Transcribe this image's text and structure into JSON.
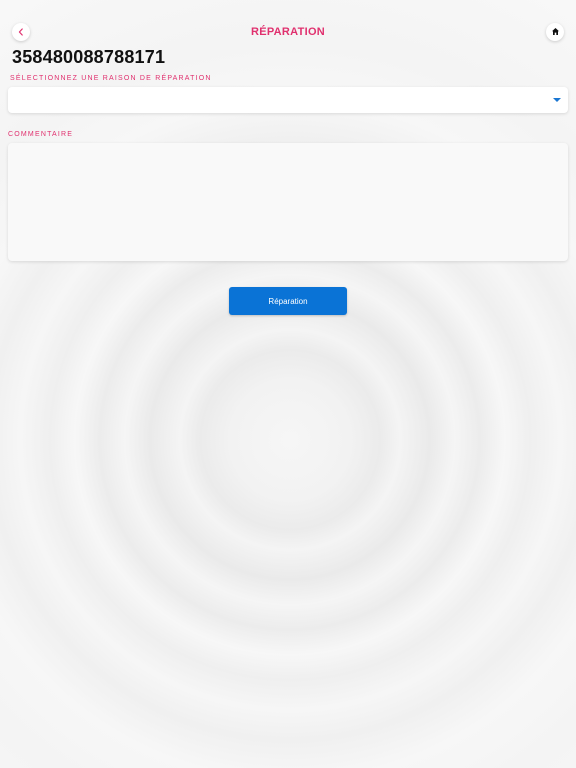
{
  "header": {
    "title": "RÉPARATION",
    "back_icon": "chevron-left-icon",
    "home_icon": "home-icon"
  },
  "serial_number": "358480088788171",
  "form": {
    "reason_label": "SÉLECTIONNEZ UNE RAISON DE RÉPARATION",
    "reason_value": "",
    "comment_label": "COMMENTAIRE",
    "comment_value": "",
    "submit_label": "Réparation"
  },
  "colors": {
    "accent": "#e0306e",
    "button": "#0a73d6",
    "caret": "#1976d2"
  }
}
